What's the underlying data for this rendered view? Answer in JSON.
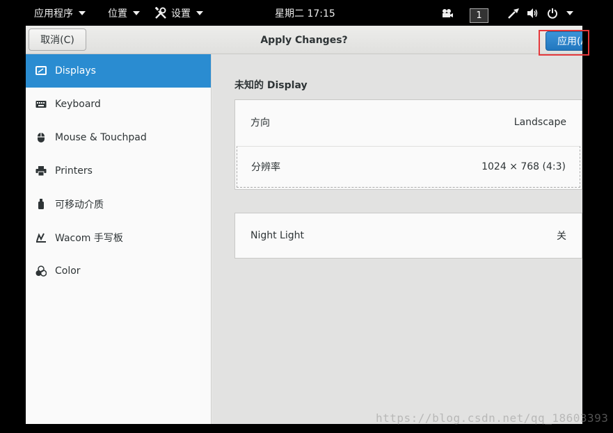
{
  "topbar": {
    "apps": "应用程序",
    "places": "位置",
    "settings": "设置",
    "clock": "星期二 17:15",
    "workspace": "1"
  },
  "headerbar": {
    "cancel_label": "取消(C)",
    "title": "Apply Changes?",
    "apply_label": "应用(A)"
  },
  "sidebar": {
    "items": [
      {
        "label": "Displays",
        "icon": "display-icon"
      },
      {
        "label": "Keyboard",
        "icon": "keyboard-icon"
      },
      {
        "label": "Mouse & Touchpad",
        "icon": "mouse-icon"
      },
      {
        "label": "Printers",
        "icon": "printer-icon"
      },
      {
        "label": "可移动介质",
        "icon": "usb-icon"
      },
      {
        "label": "Wacom 手写板",
        "icon": "tablet-icon"
      },
      {
        "label": "Color",
        "icon": "color-icon"
      }
    ]
  },
  "main": {
    "section_title": "未知的 Display",
    "orientation_label": "方向",
    "orientation_value": "Landscape",
    "resolution_label": "分辨率",
    "resolution_value": "1024 × 768 (4:3)",
    "night_light_label": "Night Light",
    "night_light_value": "关"
  },
  "watermark": "https://blog.csdn.net/qq_18603393",
  "colors": {
    "accent": "#2a8cd1",
    "highlight": "#e5383b"
  }
}
